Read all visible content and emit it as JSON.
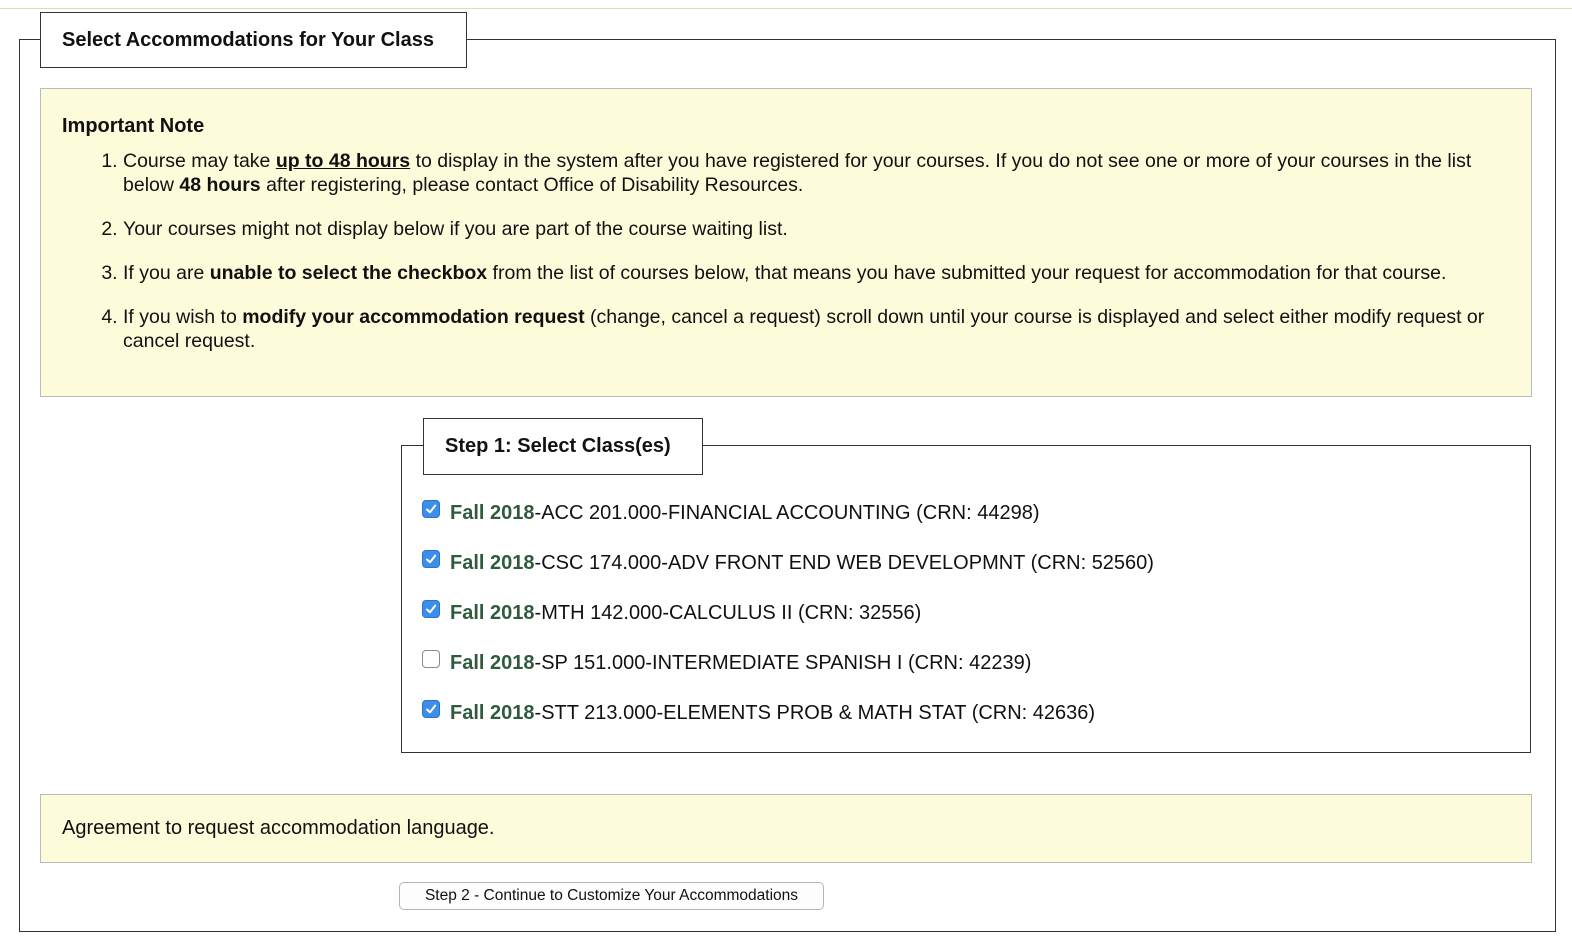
{
  "page": {
    "section_title": "Select Accommodations for Your Class"
  },
  "note": {
    "title": "Important Note",
    "item1": {
      "pre": "Course may take ",
      "emph": "up to 48 hours",
      "mid": " to display in the system after you have registered for your courses. If you do not see one or more of your courses in the list below ",
      "emph2": "48 hours",
      "post": " after registering, please contact Office of Disability Resources."
    },
    "item2": "Your courses might not display below if you are part of the course waiting list.",
    "item3": {
      "pre": "If you are ",
      "emph": "unable to select the checkbox",
      "post": " from the list of courses below, that means you have submitted your request for accommodation for that course."
    },
    "item4": {
      "pre": "If you wish to ",
      "emph": "modify your accommodation request",
      "post": " (change, cancel a request) scroll down until your course is displayed and select either modify request or cancel request."
    }
  },
  "step1": {
    "title": "Step 1: Select Class(es)",
    "separator": " - ",
    "courses": [
      {
        "term": "Fall 2018",
        "course": "ACC 201.000",
        "name": "FINANCIAL ACCOUNTING (CRN: 44298)",
        "checked": true
      },
      {
        "term": "Fall 2018",
        "course": "CSC 174.000",
        "name": "ADV FRONT END WEB DEVELOPMNT (CRN: 52560)",
        "checked": true
      },
      {
        "term": "Fall 2018",
        "course": "MTH 142.000",
        "name": "CALCULUS II (CRN: 32556)",
        "checked": true
      },
      {
        "term": "Fall 2018",
        "course": "SP 151.000",
        "name": "INTERMEDIATE SPANISH I (CRN: 42239)",
        "checked": false
      },
      {
        "term": "Fall 2018",
        "course": "STT 213.000",
        "name": "ELEMENTS PROB & MATH STAT (CRN: 42636)",
        "checked": true
      }
    ]
  },
  "agreement": {
    "text": "Agreement to request accommodation language."
  },
  "step2": {
    "button_label": "Step 2 - Continue to Customize Your Accommodations"
  },
  "colors": {
    "note_background": "#fcfcdb",
    "term_text": "#2f5a3c",
    "checkbox_checked": "#3d8ee8"
  }
}
